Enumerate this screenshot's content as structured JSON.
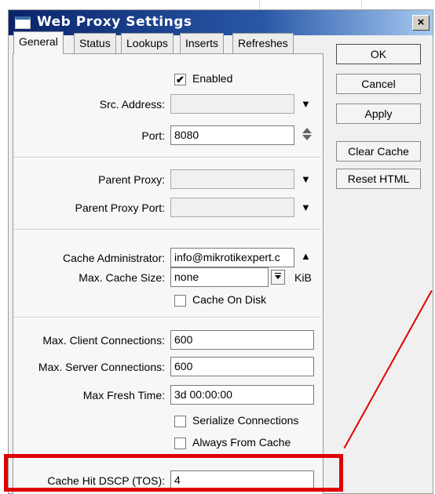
{
  "window": {
    "title": "Web Proxy Settings",
    "close_label": "×"
  },
  "tabs": [
    {
      "label": "General",
      "active": true
    },
    {
      "label": "Status"
    },
    {
      "label": "Lookups"
    },
    {
      "label": "Inserts"
    },
    {
      "label": "Refreshes"
    }
  ],
  "general": {
    "enabled": {
      "label": "Enabled",
      "checked": true,
      "mark": "✔"
    },
    "src_address": {
      "label": "Src. Address:",
      "value": ""
    },
    "port": {
      "label": "Port:",
      "value": "8080"
    },
    "parent_proxy": {
      "label": "Parent Proxy:",
      "value": ""
    },
    "parent_proxy_port": {
      "label": "Parent Proxy Port:",
      "value": ""
    },
    "cache_administrator": {
      "label": "Cache Administrator:",
      "value": "info@mikrotikexpert.c"
    },
    "max_cache_size": {
      "label": "Max. Cache Size:",
      "value": "none",
      "unit": "KiB"
    },
    "cache_on_disk": {
      "label": "Cache On Disk",
      "checked": false
    },
    "max_client_connections": {
      "label": "Max. Client Connections:",
      "value": "600"
    },
    "max_server_connections": {
      "label": "Max. Server Connections:",
      "value": "600"
    },
    "max_fresh_time": {
      "label": "Max Fresh Time:",
      "value": "3d 00:00:00"
    },
    "serialize_connections": {
      "label": "Serialize Connections",
      "checked": false
    },
    "always_from_cache": {
      "label": "Always From Cache",
      "checked": false
    },
    "cache_hit_dscp": {
      "label": "Cache Hit DSCP (TOS):",
      "value": "4"
    }
  },
  "buttons": {
    "ok": "OK",
    "cancel": "Cancel",
    "apply": "Apply",
    "clear_cache": "Clear Cache",
    "reset_html": "Reset HTML"
  },
  "colors": {
    "highlight": "#e00000",
    "title_bar": "#0a246a"
  }
}
